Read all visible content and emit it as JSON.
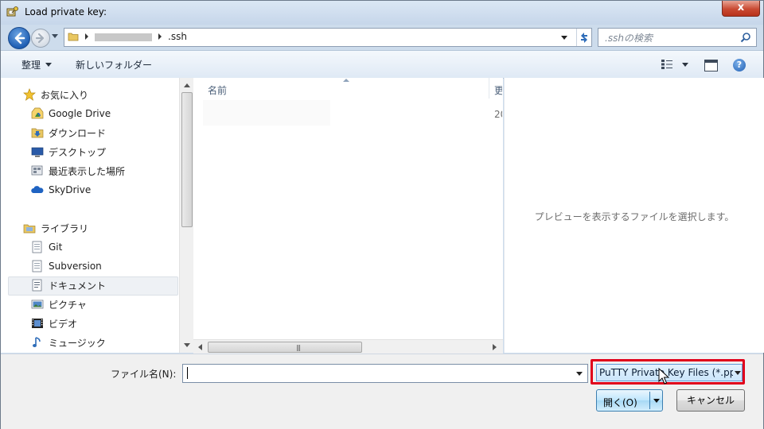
{
  "window": {
    "title": "Load private key:",
    "close_label": "x"
  },
  "address_bar": {
    "path_last": ".ssh"
  },
  "search": {
    "placeholder": ".sshの検索"
  },
  "toolbar": {
    "organize_label": "整理",
    "new_folder_label": "新しいフォルダー",
    "help_label": "?"
  },
  "nav_pane": {
    "favorites_label": "お気に入り",
    "favorites": [
      "Google Drive",
      "ダウンロード",
      "デスクトップ",
      "最近表示した場所",
      "SkyDrive"
    ],
    "libraries_label": "ライブラリ",
    "libraries": [
      "Git",
      "Subversion",
      "ドキュメント",
      "ピクチャ",
      "ビデオ",
      "ミュージック"
    ],
    "selected": "ドキュメント"
  },
  "file_list": {
    "column_name": "名前",
    "column_date_partial": "更",
    "row_date_partial": "20"
  },
  "preview": {
    "message": "プレビューを表示するファイルを選択します。"
  },
  "bottom": {
    "filename_label": "ファイル名(N):",
    "filename_value": "",
    "filter_value": "PuTTY Private Key Files (*.ppk)",
    "open_label": "開く(O)",
    "cancel_label": "キャンセル"
  },
  "colors": {
    "highlight_border": "#e0001b",
    "accent": "#1f5fb4"
  }
}
